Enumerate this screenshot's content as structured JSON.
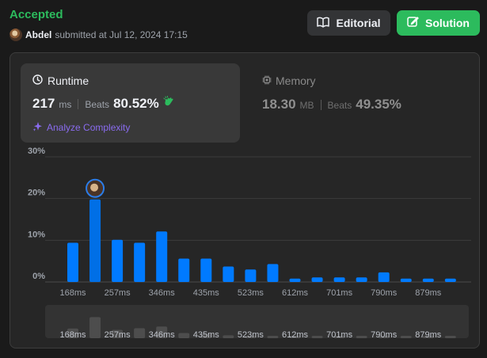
{
  "header": {
    "status": "Accepted",
    "username": "Abdel",
    "submitted_text": "submitted at Jul 12, 2024 17:15",
    "editorial_label": "Editorial",
    "solution_label": "Solution",
    "icons": {
      "editorial": "book-open-icon",
      "solution": "edit-icon"
    }
  },
  "runtime": {
    "title": "Runtime",
    "value": "217",
    "unit": "ms",
    "beats_label": "Beats",
    "beats_value": "80.52%",
    "analyze_label": "Analyze Complexity",
    "icons": {
      "title": "clock-icon",
      "beats": "clap-icon",
      "analyze": "sparkle-icon"
    }
  },
  "memory": {
    "title": "Memory",
    "value": "18.30",
    "unit": "MB",
    "beats_label": "Beats",
    "beats_value": "49.35%",
    "icons": {
      "title": "chip-icon"
    }
  },
  "colors": {
    "accepted": "#2cbb5d",
    "bar": "#007aff",
    "bar_highlight": "#006fe6",
    "analyze": "#8a6cf0",
    "panel": "#262626",
    "card": "#393939"
  },
  "chart_data": {
    "type": "bar",
    "title": "",
    "xlabel": "",
    "ylabel": "",
    "ylim": [
      0,
      30
    ],
    "yticks": [
      "30%",
      "20%",
      "10%",
      "0%"
    ],
    "grid": true,
    "categories": [
      "168ms",
      "",
      "257ms",
      "",
      "346ms",
      "",
      "435ms",
      "",
      "523ms",
      "",
      "612ms",
      "",
      "701ms",
      "",
      "790ms",
      "",
      "879ms",
      ""
    ],
    "x_tick_labels": [
      "168ms",
      "257ms",
      "346ms",
      "435ms",
      "523ms",
      "612ms",
      "701ms",
      "790ms",
      "879ms"
    ],
    "values": [
      9.4,
      19.8,
      10.1,
      9.4,
      12.1,
      5.6,
      5.6,
      3.7,
      3.0,
      4.3,
      0.8,
      1.1,
      1.1,
      1.1,
      2.3,
      0.8,
      0.8,
      0.8
    ],
    "highlight_index": 1,
    "navigator_values": [
      3.4,
      7.4,
      2.9,
      3.5,
      4.1,
      1.8,
      1.5,
      1.0,
      0.7,
      0.8,
      0.3,
      0.3,
      0.3,
      0.3,
      0.7,
      0.3,
      0.3,
      0.3
    ]
  }
}
